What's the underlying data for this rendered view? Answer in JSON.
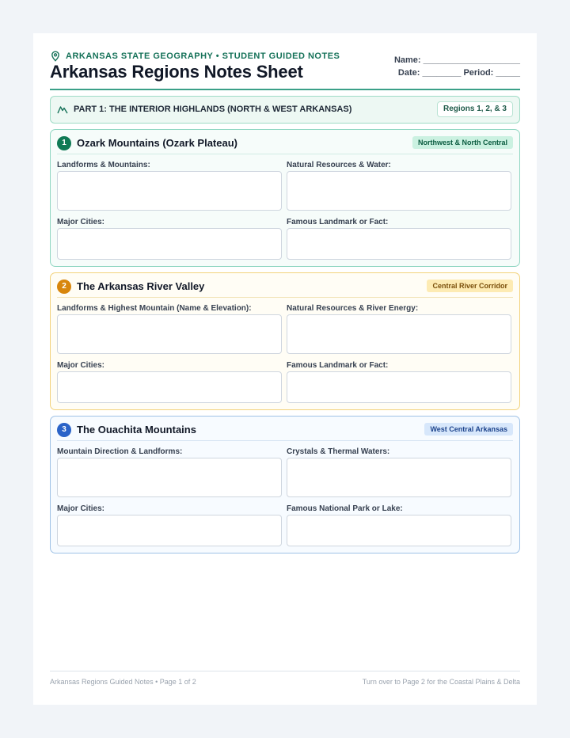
{
  "header": {
    "kicker": "ARKANSAS STATE GEOGRAPHY • STUDENT GUIDED NOTES",
    "title": "Arkansas Regions Notes Sheet",
    "name_line": "Name: ____________________",
    "date_period_line": "Date: ________ Period: _____"
  },
  "part": {
    "title": "PART 1: THE INTERIOR HIGHLANDS (NORTH & WEST ARKANSAS)",
    "badge": "Regions 1, 2, & 3"
  },
  "regions": [
    {
      "number": "1",
      "title": "Ozark Mountains (Ozark Plateau)",
      "badge": "Northwest & North Central",
      "fields": [
        "Landforms & Mountains:",
        "Natural Resources & Water:",
        "Major Cities:",
        "Famous Landmark or Fact:"
      ]
    },
    {
      "number": "2",
      "title": "The Arkansas River Valley",
      "badge": "Central River Corridor",
      "fields": [
        "Landforms & Highest Mountain (Name & Elevation):",
        "Natural Resources & River Energy:",
        "Major Cities:",
        "Famous Landmark or Fact:"
      ]
    },
    {
      "number": "3",
      "title": "The Ouachita Mountains",
      "badge": "West Central Arkansas",
      "fields": [
        "Mountain Direction & Landforms:",
        "Crystals & Thermal Waters:",
        "Major Cities:",
        "Famous National Park or Lake:"
      ]
    }
  ],
  "footer": {
    "left": "Arkansas Regions Guided Notes • Page 1 of 2",
    "right": "Turn over to Page 2 for the Coastal Plains & Delta"
  },
  "icons": {
    "kicker": "map-pin-icon",
    "part": "mountain-icon"
  },
  "colors": {
    "accent": "#167259",
    "region1": "#0f7a55",
    "region2": "#d8860c",
    "region3": "#2a63c8"
  }
}
